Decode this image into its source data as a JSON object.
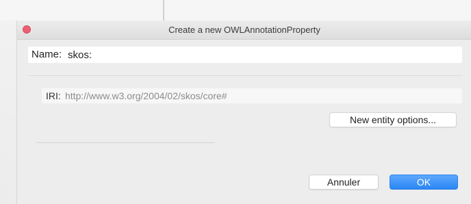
{
  "dialog": {
    "title": "Create a new OWLAnnotationProperty",
    "name_label": "Name:",
    "name_value": "skos:",
    "iri_label": "IRI:",
    "iri_value": "http://www.w3.org/2004/02/skos/core#",
    "new_entity_options_label": "New entity options...",
    "cancel_label": "Annuler",
    "ok_label": "OK"
  },
  "colors": {
    "close_button": "#ee5e72",
    "primary_button": "#2a86f3",
    "dialog_background": "#ededed"
  }
}
